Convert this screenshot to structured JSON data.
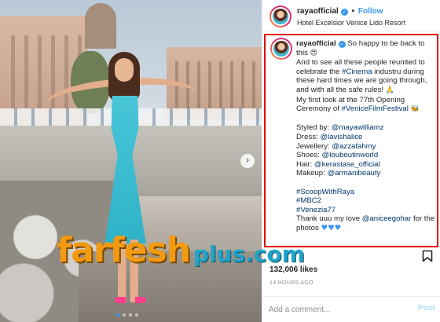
{
  "post": {
    "username": "rayaofficial",
    "follow_label": "Follow",
    "separator": "•",
    "location": "Hotel Excelsior Venice Lido Resort",
    "icons": {
      "verified": "verified-badge-icon",
      "carousel_next": "chevron-right-icon",
      "bookmark": "bookmark-icon",
      "heart_eyes": "heart-eyes-emoji",
      "praying": "praying-hands-emoji",
      "bee": "bee-emoji",
      "blue_heart": "blue-heart-emoji"
    },
    "carousel": {
      "slides": 4,
      "active": 0
    }
  },
  "caption": {
    "line1": "So happy to be back to this",
    "line2_pre": "And to see all these people reunited to celebrate the ",
    "line2_tag": "#Cinema",
    "line2_post": " industru during these hard times we are going through, and with all the safe rules!",
    "line3_pre": "My first look at the 77th Opening Ceremony of ",
    "line3_tag": "#VeniceFilmFestival",
    "credits": [
      {
        "label": "Styled by: ",
        "handle": "@mayawilliamz"
      },
      {
        "label": "Dress: ",
        "handle": "@lavishalice"
      },
      {
        "label": "Jewellery: ",
        "handle": "@azzafahmy"
      },
      {
        "label": "Shoes: ",
        "handle": "@louboutinworld"
      },
      {
        "label": "Hair: ",
        "handle": "@kerastase_official"
      },
      {
        "label": "Makeup: ",
        "handle": "@armanibeauty"
      }
    ],
    "hashtags": [
      "#ScoopWithRaya",
      "#MBC2",
      "#Venezia77"
    ],
    "thanks_pre": "Thank uuu my love ",
    "thanks_handle": "@aniceegohar",
    "thanks_post": " for the photos"
  },
  "stats": {
    "likes": "132,006 likes",
    "time": "14 HOURS AGO"
  },
  "comment": {
    "placeholder": "Add a comment...",
    "post_label": "Post"
  },
  "watermark": {
    "main": "farfesh",
    "sub": "plus.com"
  },
  "colors": {
    "link": "#00376b",
    "follow": "#3897f0",
    "highlight_border": "#e00000",
    "post_disabled": "#b2dffc"
  }
}
